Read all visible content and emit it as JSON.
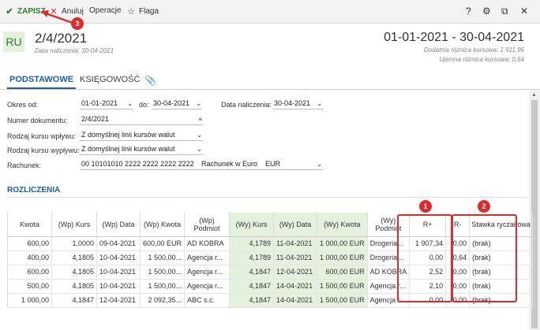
{
  "toolbar": {
    "save": "ZAPISZ",
    "cancel": "Anuluj",
    "operations": "Operacje",
    "flag": "Flaga",
    "help": "?",
    "icons": [
      "check-icon",
      "x-icon",
      "star-icon",
      "help-icon",
      "gear-icon",
      "popout-icon",
      "close-icon"
    ]
  },
  "header": {
    "badge": "RU",
    "doc_number": "2/4/2021",
    "accrual_date": "Data naliczenia: 30-04-2021",
    "period": "01-01-2021 - 30-04-2021",
    "positive_diff": "Dodatnia różnica kursowa: 1 911,96",
    "negative_diff": "Ujemna różnica kursowa: 0,64"
  },
  "tabs": [
    "PODSTAWOWE",
    "KSIĘGOWOŚĆ",
    "paperclip-icon"
  ],
  "form": {
    "period_label": "Okres od:",
    "period_from": "01-01-2021",
    "to_label": "do:",
    "period_to": "30-04-2021",
    "accrual_label": "Data naliczenia:",
    "accrual_value": "30-04-2021",
    "docnum_label": "Numer dokumentu:",
    "docnum_value": "2/4/2021",
    "inflow_label": "Rodzaj kursu wpływu:",
    "inflow_value": "Z domyślnej linii kursów walut",
    "outflow_label": "Rodzaj kursu wypływu:",
    "outflow_value": "Z domyślnej linii kursów walut",
    "account_label": "Rachunek:",
    "account_value": "00 10101010 2222 2222 2222 2222",
    "account_name": "Rachunek w Euro",
    "currency": "EUR"
  },
  "section_title": "ROZLICZENIA",
  "table": {
    "headers": [
      "Kwota",
      "(Wp) Kurs",
      "(Wp) Data",
      "(Wp) Kwota",
      "(Wp) Podmiot",
      "(Wy) Kurs",
      "(Wy) Data",
      "(Wy) Kwota",
      "(Wy) Podmiot",
      "R+",
      "R-",
      "Stawka ryczałtowa"
    ],
    "rows": [
      [
        "600,00",
        "1,0000",
        "09-04-2021",
        "600,00 EUR",
        "AD KOBRA",
        "4,1789",
        "11-04-2021",
        "1 000,00 EUR",
        "Drogeria...",
        "1 907,34",
        "0,00",
        "(brak)"
      ],
      [
        "400,00",
        "4,1805",
        "10-04-2021",
        "1 500,00...",
        "Agencja r...",
        "4,1789",
        "11-04-2021",
        "1 000,00 EUR",
        "Drogeria...",
        "0,00",
        "0,64",
        "(brak)"
      ],
      [
        "600,00",
        "4,1805",
        "10-04-2021",
        "1 500,00...",
        "Agencja r...",
        "4,1847",
        "12-04-2021",
        "600,00 EUR",
        "AD KOBRA",
        "2,52",
        "0,00",
        "(brak)"
      ],
      [
        "500,00",
        "4,1805",
        "10-04-2021",
        "1 500,00...",
        "Agencja r...",
        "4,1847",
        "14-04-2021",
        "1 500,00 EUR",
        "Agencja r...",
        "2,10",
        "0,00",
        "(brak)"
      ],
      [
        "1 000,00",
        "4,1847",
        "12-04-2021",
        "2 092,35...",
        "ABC s.c.",
        "4,1847",
        "14-04-2021",
        "1 500,00 EUR",
        "Agencja r...",
        "0,00",
        "0,00",
        "(brak)"
      ]
    ]
  },
  "annotations": [
    "1",
    "2",
    "3"
  ],
  "colors": {
    "accent": "#1a5fa8",
    "green": "#2e7d32",
    "highlight": "#e02b2b",
    "green_bg": "#e4f2dd"
  }
}
